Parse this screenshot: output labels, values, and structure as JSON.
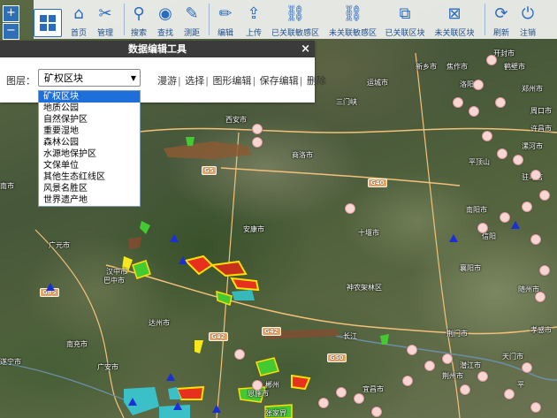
{
  "map": {
    "labels": [
      "西安市",
      "商洛市",
      "运城市",
      "洛阳市",
      "郑州市",
      "开封市",
      "安康市",
      "十堰市",
      "南阳市",
      "广元市",
      "巴中市",
      "达州市",
      "襄阳市",
      "荆门市",
      "南充市",
      "遂宁市",
      "广安市",
      "恩施市",
      "宜昌市",
      "荆州市",
      "驻马店",
      "漯河市",
      "平顶山",
      "周口市",
      "汉中市",
      "神农架林区",
      "三门峡",
      "许昌市",
      "随州市",
      "孝感市",
      "天门市",
      "潜江市",
      "鹤壁市",
      "焦作市",
      "新乡市",
      "南市",
      "长江",
      "郴州",
      "张家界",
      "平",
      "信阳"
    ],
    "road_shields": [
      "G5",
      "G40",
      "G42",
      "G42",
      "G50",
      "G85"
    ]
  },
  "zoom": {
    "in": "+",
    "out": "−"
  },
  "toolbar": {
    "items": [
      {
        "id": "home",
        "label": "首页",
        "icon": "⌂"
      },
      {
        "id": "manage",
        "label": "管理",
        "icon": "✂"
      },
      {
        "id": "search",
        "label": "搜索",
        "icon": "⚲"
      },
      {
        "id": "browse",
        "label": "查找",
        "icon": "◉"
      },
      {
        "id": "measure",
        "label": "测距",
        "icon": "✎"
      },
      {
        "id": "edit",
        "label": "编辑",
        "icon": "✏"
      },
      {
        "id": "upload",
        "label": "上传",
        "icon": "⇪"
      },
      {
        "id": "linked",
        "label": "已关联敏感区",
        "icon": "⛓"
      },
      {
        "id": "unlinked",
        "label": "未关联敏感区",
        "icon": "⛓"
      },
      {
        "id": "linked_block",
        "label": "已关联区块",
        "icon": "⧉"
      },
      {
        "id": "unlinked_block",
        "label": "未关联区块",
        "icon": "⊠"
      },
      {
        "id": "refresh",
        "label": "刷新",
        "icon": "⟳"
      },
      {
        "id": "logout",
        "label": "注销",
        "icon": "⏻"
      }
    ]
  },
  "panel": {
    "title": "数据编辑工具",
    "close": "×",
    "layer_label": "图层：",
    "selected_layer": "矿权区块",
    "actions": [
      "漫游",
      "选择",
      "图形编辑",
      "保存编辑",
      "删除"
    ],
    "options": [
      "矿权区块",
      "地质公园",
      "自然保护区",
      "重要湿地",
      "森林公园",
      "水源地保护区",
      "文保单位",
      "其他生态红线区",
      "风景名胜区",
      "世界遗产地"
    ]
  },
  "colors": {
    "accent": "#2a6bc2",
    "selected": "#1e6fd9",
    "header": "#3b3b3b",
    "poi": "#f6d7d3",
    "marker": "#1a2fd6"
  }
}
